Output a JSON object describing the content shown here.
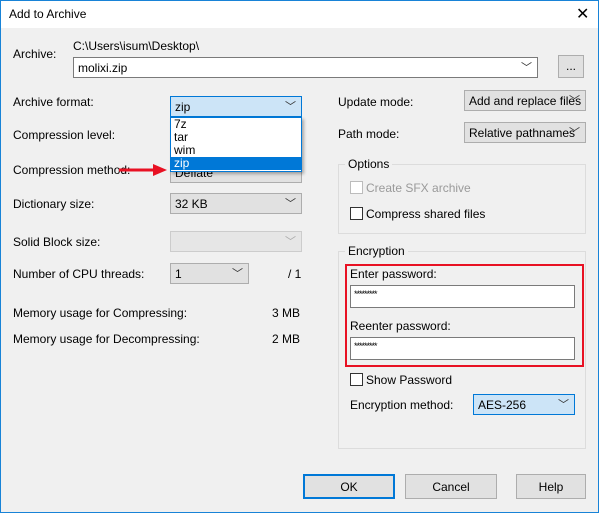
{
  "window": {
    "title": "Add to Archive",
    "close_icon": "close-icon"
  },
  "archive": {
    "label": "Archive:",
    "path": "C:\\Users\\isum\\Desktop\\",
    "value": "molixi.zip",
    "browse_label": "..."
  },
  "left": {
    "archive_format": {
      "label": "Archive format:",
      "value": "zip",
      "options": [
        "7z",
        "tar",
        "wim",
        "zip"
      ],
      "selected": "zip"
    },
    "compression_level": {
      "label": "Compression level:"
    },
    "compression_method": {
      "label": "Compression method:",
      "value": "Deflate"
    },
    "dictionary_size": {
      "label": "Dictionary size:",
      "value": "32 KB"
    },
    "solid_block_size": {
      "label": "Solid Block size:",
      "value": ""
    },
    "cpu_threads": {
      "label": "Number of CPU threads:",
      "value": "1",
      "max": "/ 1"
    },
    "memory_compress": {
      "label": "Memory usage for Compressing:",
      "value": "3 MB"
    },
    "memory_decompress": {
      "label": "Memory usage for Decompressing:",
      "value": "2 MB"
    }
  },
  "right": {
    "update_mode": {
      "label": "Update mode:",
      "value": "Add and replace files"
    },
    "path_mode": {
      "label": "Path mode:",
      "value": "Relative pathnames"
    },
    "options": {
      "title": "Options",
      "create_sfx": {
        "label": "Create SFX archive",
        "checked": false,
        "disabled": true
      },
      "compress_shared": {
        "label": "Compress shared files",
        "checked": false
      }
    },
    "encryption": {
      "title": "Encryption",
      "enter_label": "Enter password:",
      "enter_value": "*********",
      "reenter_label": "Reenter password:",
      "reenter_value": "*********",
      "show_password": {
        "label": "Show Password",
        "checked": false
      },
      "method_label": "Encryption method:",
      "method_value": "AES-256"
    }
  },
  "buttons": {
    "ok": "OK",
    "cancel": "Cancel",
    "help": "Help"
  },
  "colors": {
    "accent": "#0078d7",
    "highlight_box": "#e81123",
    "arrow": "#e81123"
  }
}
